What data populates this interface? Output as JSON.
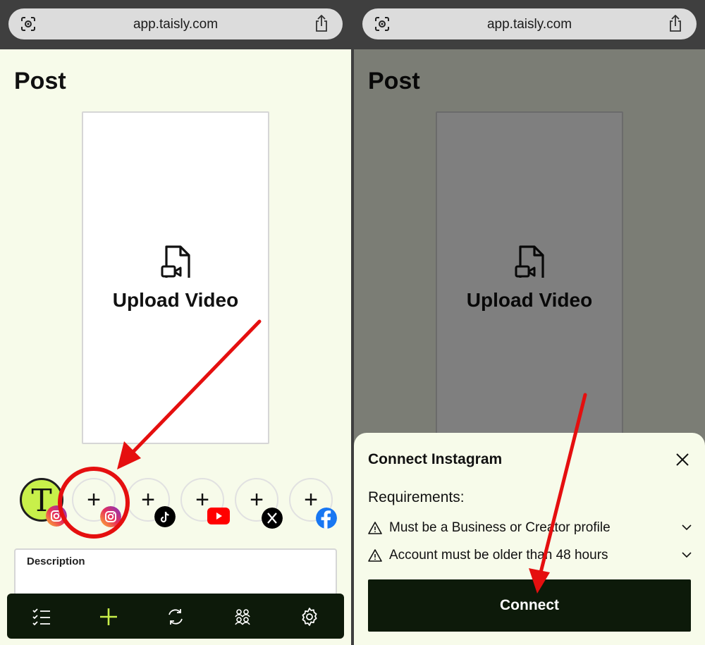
{
  "browser": {
    "url": "app.taisly.com"
  },
  "page": {
    "title": "Post",
    "upload_label": "Upload Video",
    "description_label": "Description"
  },
  "accounts": [
    {
      "kind": "connected",
      "letter": "T",
      "platform": "instagram"
    },
    {
      "kind": "add",
      "platform": "instagram"
    },
    {
      "kind": "add",
      "platform": "tiktok"
    },
    {
      "kind": "add",
      "platform": "youtube"
    },
    {
      "kind": "add",
      "platform": "x"
    },
    {
      "kind": "add",
      "platform": "facebook"
    }
  ],
  "tabbar": [
    "checklist-icon",
    "plus-icon",
    "refresh-icon",
    "group-icon",
    "gear-icon"
  ],
  "sheet": {
    "title": "Connect Instagram",
    "requirements_heading": "Requirements:",
    "requirements": [
      "Must be a Business or Creator profile",
      "Account must be older than 48 hours"
    ],
    "connect_label": "Connect"
  },
  "colors": {
    "accent": "#c8f04a",
    "dark": "#0d1a0a",
    "annotation": "#e50f0f",
    "page_bg": "#f7fbea"
  }
}
